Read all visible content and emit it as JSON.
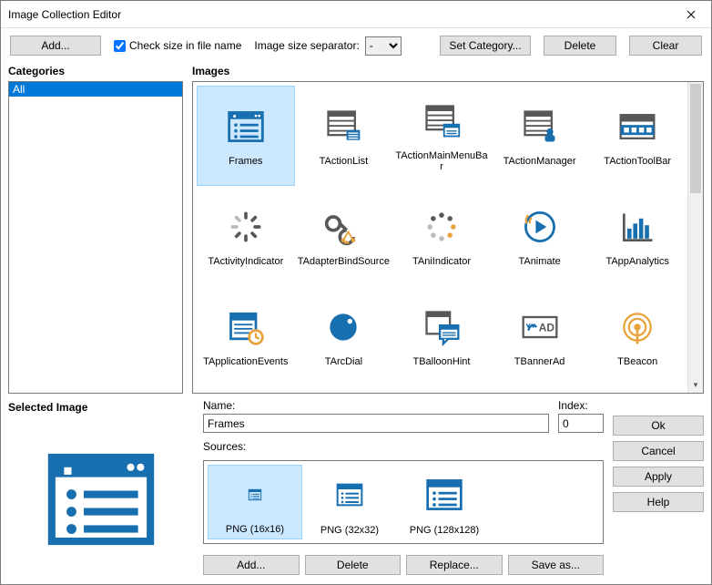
{
  "window": {
    "title": "Image Collection Editor"
  },
  "toolbar": {
    "add": "Add...",
    "check_size": "Check size in file name",
    "check_size_checked": true,
    "sep_label": "Image size separator:",
    "sep_value": "-",
    "set_category": "Set Category...",
    "delete": "Delete",
    "clear": "Clear"
  },
  "categories": {
    "label": "Categories",
    "items": [
      "All"
    ]
  },
  "images": {
    "label": "Images",
    "items": [
      {
        "name": "Frames",
        "icon": "frames",
        "selected": true
      },
      {
        "name": "TActionList",
        "icon": "actionlist"
      },
      {
        "name": "TActionMainMenuBar",
        "icon": "mainmenubar"
      },
      {
        "name": "TActionManager",
        "icon": "actionmanager"
      },
      {
        "name": "TActionToolBar",
        "icon": "toolbar"
      },
      {
        "name": "TActivityIndicator",
        "icon": "activity"
      },
      {
        "name": "TAdapterBindSource",
        "icon": "adapter"
      },
      {
        "name": "TAniIndicator",
        "icon": "aniindicator"
      },
      {
        "name": "TAnimate",
        "icon": "animate"
      },
      {
        "name": "TAppAnalytics",
        "icon": "analytics"
      },
      {
        "name": "TApplicationEvents",
        "icon": "appevents"
      },
      {
        "name": "TArcDial",
        "icon": "arcdial"
      },
      {
        "name": "TBalloonHint",
        "icon": "balloon"
      },
      {
        "name": "TBannerAd",
        "icon": "banner"
      },
      {
        "name": "TBeacon",
        "icon": "beacon"
      }
    ]
  },
  "selected": {
    "label": "Selected Image",
    "name_label": "Name:",
    "name_value": "Frames",
    "index_label": "Index:",
    "index_value": "0",
    "sources_label": "Sources:",
    "sources": [
      {
        "label": "PNG (16x16)",
        "selected": true
      },
      {
        "label": "PNG (32x32)"
      },
      {
        "label": "PNG (128x128)"
      }
    ],
    "buttons": {
      "add": "Add...",
      "delete": "Delete",
      "replace": "Replace...",
      "saveas": "Save as..."
    }
  },
  "actions": {
    "ok": "Ok",
    "cancel": "Cancel",
    "apply": "Apply",
    "help": "Help"
  }
}
